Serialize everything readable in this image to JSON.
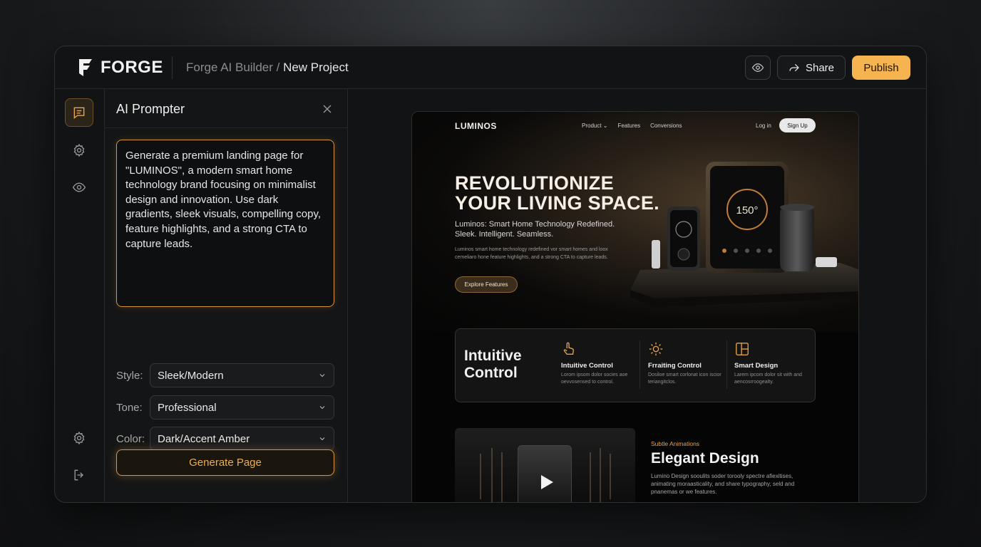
{
  "app": {
    "name": "FORGE",
    "logo_icon": "forge-logo-icon"
  },
  "breadcrumb": {
    "parent": "Forge AI Builder",
    "separator": " / ",
    "current": "New Project"
  },
  "header": {
    "preview_icon": "eye-icon",
    "share_label": "Share",
    "share_icon": "share-arrow-icon",
    "publish_label": "Publish"
  },
  "rail": {
    "items": [
      {
        "icon": "chat-prompt-icon",
        "active": true
      },
      {
        "icon": "gear-icon",
        "active": false
      },
      {
        "icon": "eye-icon",
        "active": false
      },
      {
        "icon": "gear-icon",
        "active": false
      },
      {
        "icon": "logout-icon",
        "active": false
      }
    ]
  },
  "panel": {
    "title": "AI Prompter",
    "prompt_text": "Generate a premium landing page for \"LUMINOS\", a modern smart home technology brand focusing on minimalist design and innovation. Use dark gradients, sleek visuals, compelling copy, feature highlights, and a strong CTA to capture leads.",
    "options": [
      {
        "label": "Style:",
        "value": "Sleek/Modern"
      },
      {
        "label": "Tone:",
        "value": "Professional"
      },
      {
        "label": "Color:",
        "value": "Dark/Accent Amber"
      }
    ],
    "generate_label": "Generate Page"
  },
  "preview": {
    "brand": "LUMINOS",
    "nav": [
      "Product ⌄",
      "Features",
      "Conversions"
    ],
    "login": "Log in",
    "signup": "Sign Up",
    "hero_title_1": "REVOLUTIONIZE",
    "hero_title_2": "YOUR LIVING SPACE.",
    "hero_sub_1": "Luminos: Smart Home Technology Redefined.",
    "hero_sub_2": "Sleek. Intelligent. Seamless.",
    "hero_small": "Luminos smart home technology redefined vor smart homes and loox cemeliaro hone feature highlights, and a strong CTA to capture leads.",
    "hero_cta": "Explore Features",
    "thermostat_readout": "150°",
    "feature_title_1": "Intuitive",
    "feature_title_2": "Control",
    "features": [
      {
        "icon": "hand-touch-icon",
        "name": "Intuitive Control",
        "desc": "Lorom ipsom dolor socies aoe oevvosensed to control."
      },
      {
        "icon": "sun-icon",
        "name": "Frraiting Control",
        "desc": "Dosiloe smart corlonat icon iscior teriangitclos."
      },
      {
        "icon": "layout-panels-icon",
        "name": "Smart Design",
        "desc": "Larem ipcom dolor sit with and aencosrroogealty."
      }
    ],
    "eyebrow": "Subtle Animations",
    "design_title": "Elegant Design",
    "design_desc": "Lumino Design sooulits soder torooly spectre afiexitises, animating moraasticality, and share typography, seld and pnanemas or we features.",
    "accent_color": "#f5b44f"
  }
}
